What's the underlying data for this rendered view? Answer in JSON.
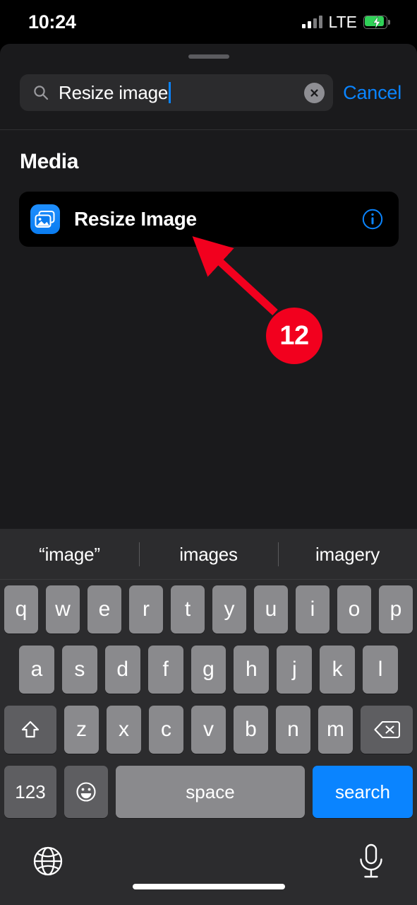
{
  "status_bar": {
    "time": "10:24",
    "carrier_network": "LTE",
    "signal_icon": "cellular-signal-icon",
    "battery_icon": "battery-charging-icon",
    "battery_color": "#30d158"
  },
  "sheet": {
    "grabber": "sheet-grabber-handle",
    "search": {
      "icon": "search-icon",
      "value": "Resize image",
      "placeholder": "Search",
      "clear_icon": "clear-circle-icon",
      "cancel_label": "Cancel",
      "cancel_color": "#0a84ff",
      "caret_color": "#0a84ff"
    },
    "results": {
      "section_title": "Media",
      "items": [
        {
          "label": "Resize Image",
          "icon": "photo-stack-icon",
          "icon_color": "#0a84ff",
          "info_icon": "info-circle-icon"
        }
      ]
    }
  },
  "annotation": {
    "badge_number": "12",
    "badge_color": "#f2001e",
    "arrow_icon": "pointer-arrow-icon",
    "arrow_color": "#f2001e"
  },
  "keyboard": {
    "predictions": [
      "“image”",
      "images",
      "imagery"
    ],
    "row1": [
      "q",
      "w",
      "e",
      "r",
      "t",
      "y",
      "u",
      "i",
      "o",
      "p"
    ],
    "row2": [
      "a",
      "s",
      "d",
      "f",
      "g",
      "h",
      "j",
      "k",
      "l"
    ],
    "row3_letters": [
      "z",
      "x",
      "c",
      "v",
      "b",
      "n",
      "m"
    ],
    "shift_icon": "shift-arrow-icon",
    "backspace_icon": "backspace-delete-icon",
    "numbers_label": "123",
    "emoji_icon": "emoji-smiley-icon",
    "space_label": "space",
    "return_label": "search",
    "return_color": "#0a84ff",
    "globe_icon": "globe-language-icon",
    "mic_icon": "microphone-dictation-icon",
    "home_indicator": "home-indicator-bar"
  }
}
